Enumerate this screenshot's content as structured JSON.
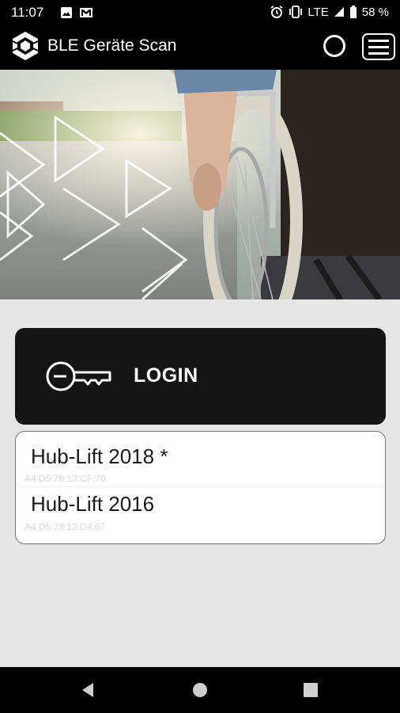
{
  "status_bar": {
    "time": "11:07",
    "network": "LTE",
    "battery": "58 %"
  },
  "app_bar": {
    "title": "BLE Geräte Scan"
  },
  "login": {
    "label": "LOGIN"
  },
  "devices": [
    {
      "name": "Hub-Lift 2018  *",
      "mac": "A4:D5:78:13:CF:70"
    },
    {
      "name": "Hub-Lift 2016",
      "mac": "A4:D5:78:13:D4:67"
    }
  ],
  "icons": {
    "status_left": [
      "image-icon",
      "gmail-icon"
    ],
    "status_right": [
      "alarm-icon",
      "vibrate-icon",
      "signal-icon",
      "battery-icon"
    ],
    "app": [
      "app-logo-icon",
      "circle-icon",
      "hamburger-menu-icon"
    ],
    "login": "key-icon",
    "nav": [
      "back-icon",
      "home-icon",
      "recents-icon"
    ]
  },
  "colors": {
    "bar_background": "#000000",
    "login_button": "#151515",
    "page_background": "#e6e6e6"
  }
}
